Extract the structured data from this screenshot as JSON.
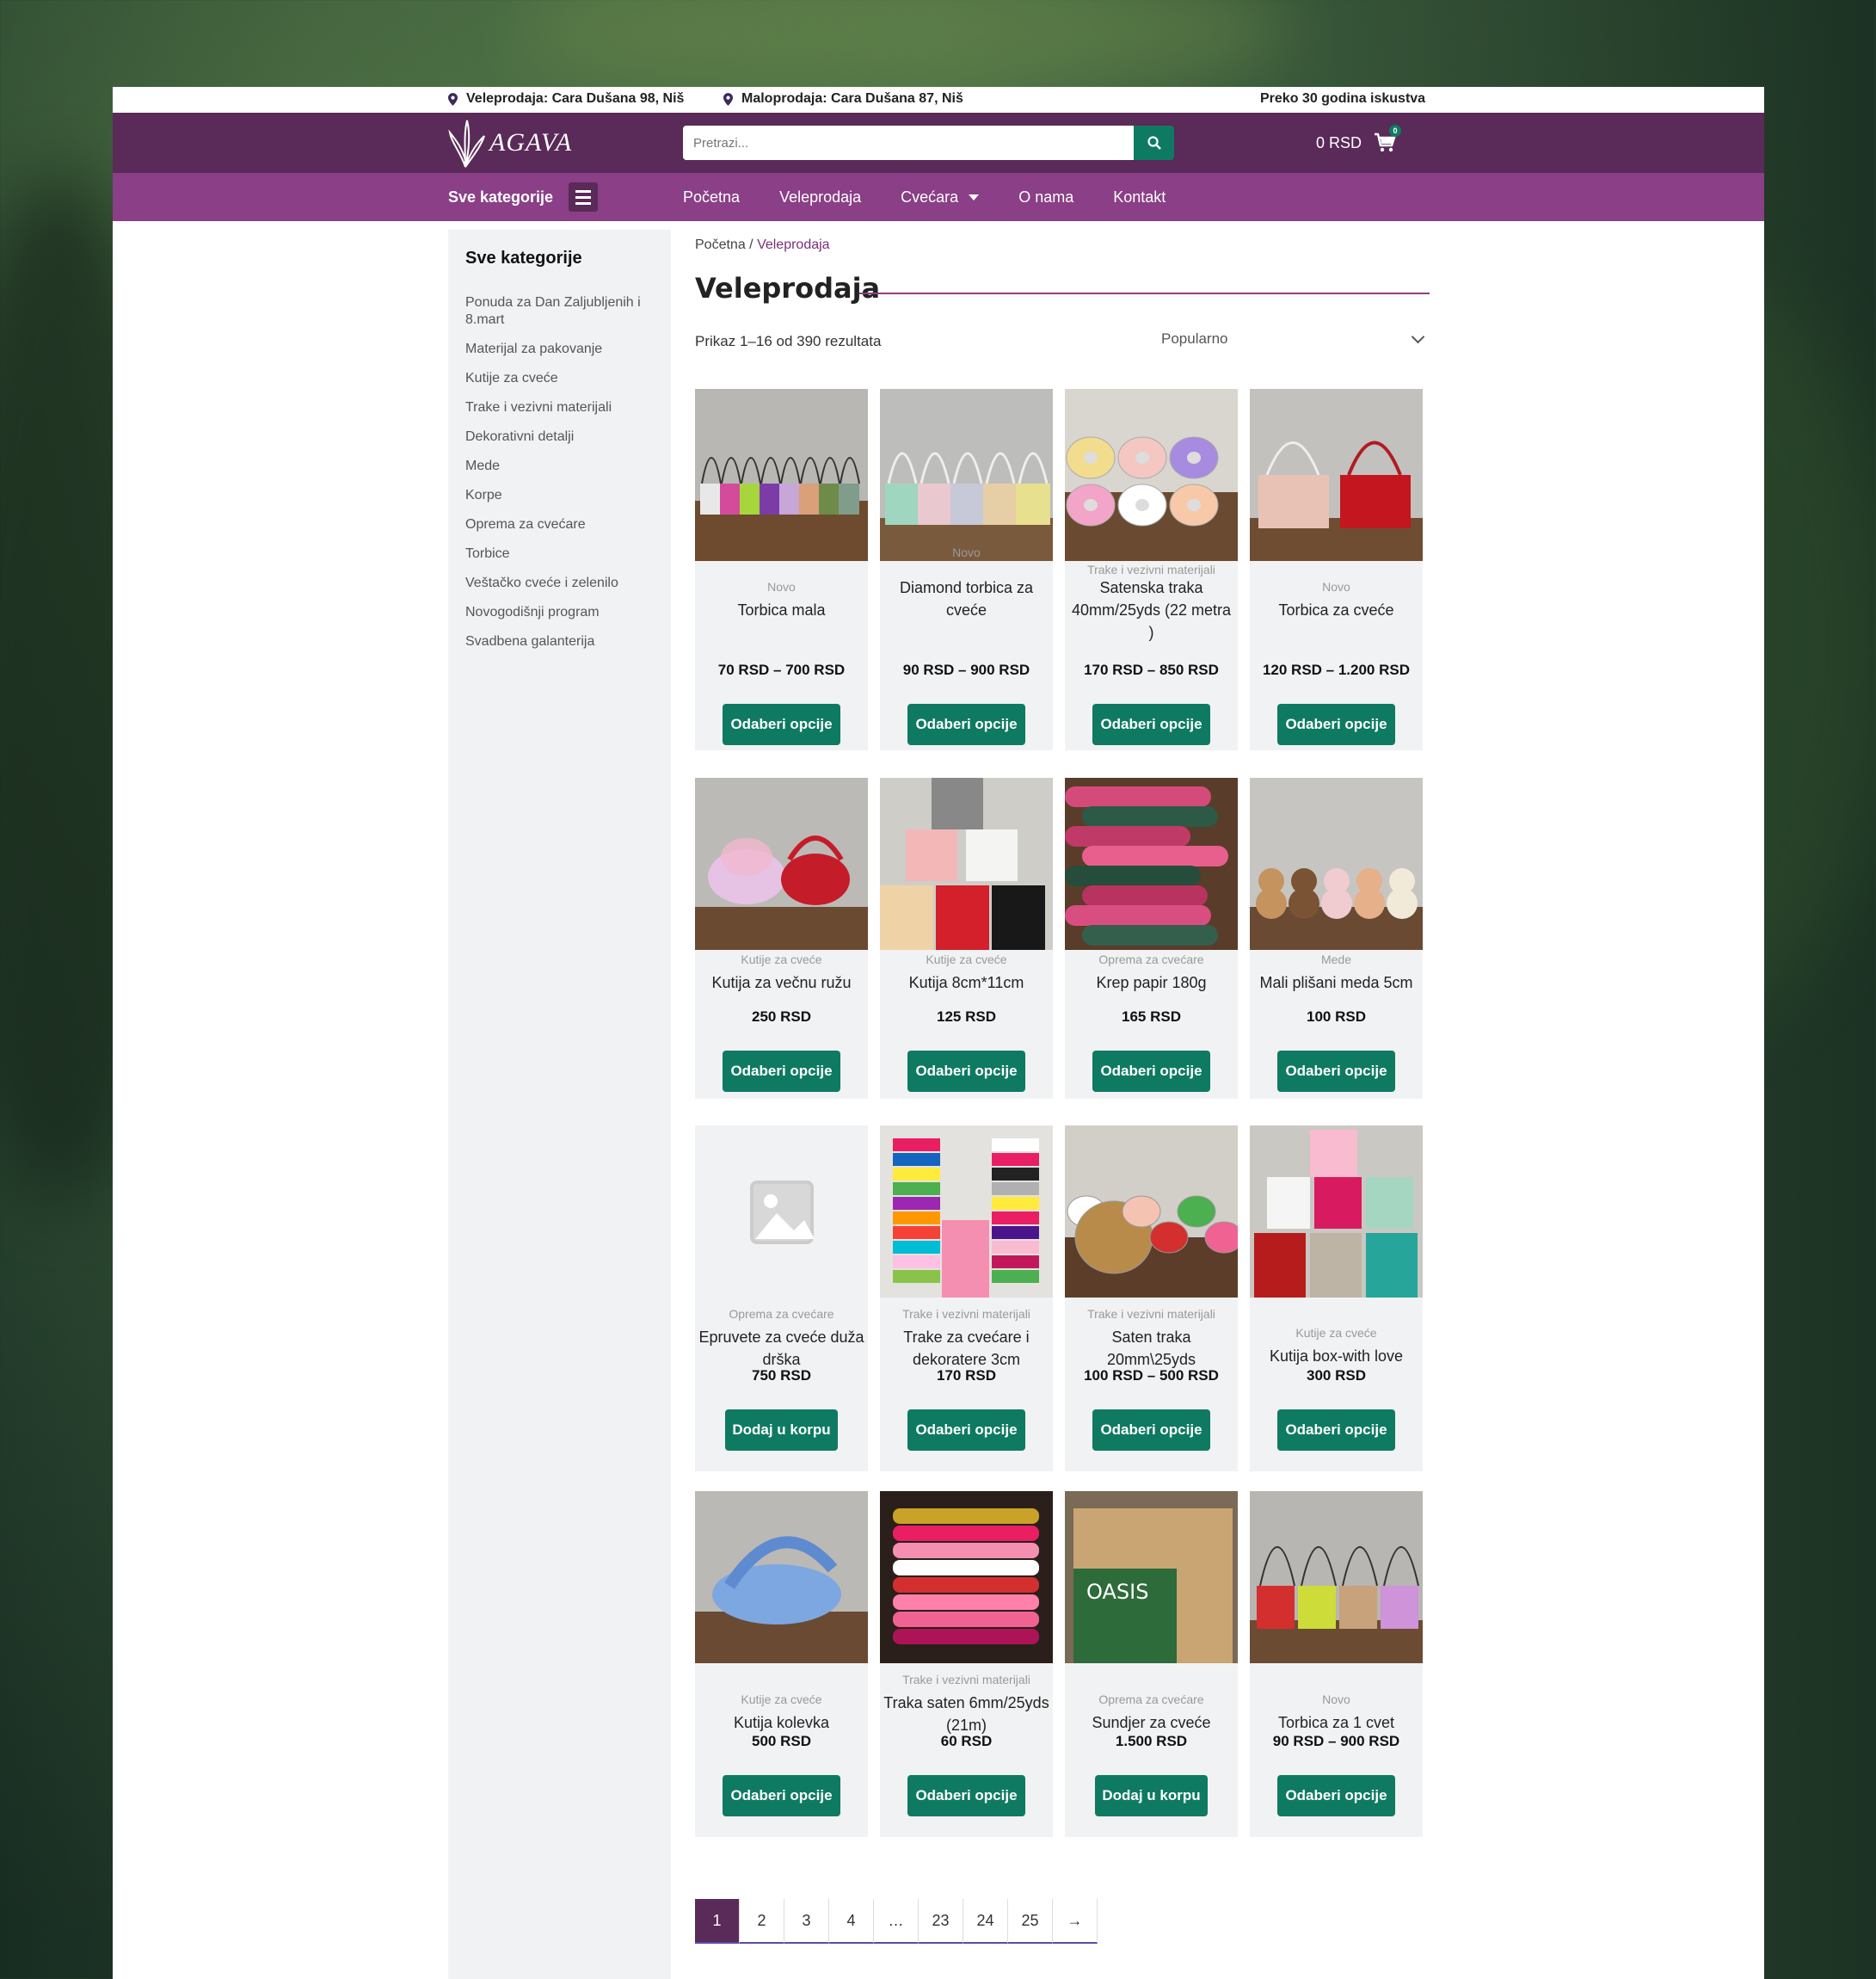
{
  "topbar": {
    "wholesale": "Veleprodaja: Cara Dušana 98, Niš",
    "retail": "Maloprodaja: Cara Dušana 87, Niš",
    "experience": "Preko 30 godina iskustva"
  },
  "header": {
    "logo_text": "AGAVA",
    "search_placeholder": "Pretrazi...",
    "cart_total": "0 RSD",
    "cart_count": "0"
  },
  "nav": {
    "all_categories": "Sve kategorije",
    "items": [
      "Početna",
      "Veleprodaja",
      "Cvećara",
      "O nama",
      "Kontakt"
    ]
  },
  "sidebar": {
    "title": "Sve kategorije",
    "items": [
      "Ponuda za Dan Zaljubljenih i 8.mart",
      "Materijal za pakovanje",
      "Kutije za cveće",
      "Trake i vezivni materijali",
      "Dekorativni detalji",
      "Mede",
      "Korpe",
      "Oprema za cvećare",
      "Torbice",
      "Veštačko cveće i zelenilo",
      "Novogodišnji program",
      "Svadbena galanterija"
    ]
  },
  "breadcrumb": {
    "home": "Početna",
    "sep": " / ",
    "current": "Veleprodaja"
  },
  "page_title": "Veleprodaja",
  "result_count": "Prikaz 1–16 od 390 rezultata",
  "sort": {
    "selected": "Popularno"
  },
  "products": [
    {
      "category": "Novo",
      "name": "Torbica mala",
      "price": "70 RSD – 700 RSD",
      "button": "Odaberi opcije",
      "image": "bags-colorful"
    },
    {
      "category": "Novo",
      "name": "Diamond torbica za cveće",
      "price": "90 RSD – 900 RSD",
      "button": "Odaberi opcije",
      "image": "bags-pastel"
    },
    {
      "category": "Trake i vezivni materijali",
      "name": "Satenska traka 40mm/25yds (22 metra )",
      "price": "170 RSD – 850 RSD",
      "button": "Odaberi opcije",
      "image": "ribbons-wide"
    },
    {
      "category": "Novo",
      "name": "Torbica za cveće",
      "price": "120 RSD – 1.200 RSD",
      "button": "Odaberi opcije",
      "image": "bags-pink-red"
    },
    {
      "category": "Kutije za cveće",
      "name": "Kutija za večnu ružu",
      "price": "250 RSD",
      "button": "Odaberi opcije",
      "image": "rose-box"
    },
    {
      "category": "Kutije za cveće",
      "name": "Kutija 8cm*11cm",
      "price": "125 RSD",
      "button": "Odaberi opcije",
      "image": "box-stack"
    },
    {
      "category": "Oprema za cvećare",
      "name": "Krep papir 180g",
      "price": "165 RSD",
      "button": "Odaberi opcije",
      "image": "crepe-paper"
    },
    {
      "category": "Mede",
      "name": "Mali plišani meda 5cm",
      "price": "100 RSD",
      "button": "Odaberi opcije",
      "image": "teddy-bears"
    },
    {
      "category": "Oprema za cvećare",
      "name": "Epruvete za cveće duža drška",
      "price": "750 RSD",
      "button": "Dodaj u korpu",
      "image": "placeholder"
    },
    {
      "category": "Trake i vezivni materijali",
      "name": "Trake za cvećare i dekoratere 3cm",
      "price": "170 RSD",
      "button": "Odaberi opcije",
      "image": "ribbon-towers"
    },
    {
      "category": "Trake i vezivni materijali",
      "name": "Saten traka 20mm\\25yds",
      "price": "100 RSD – 500 RSD",
      "button": "Odaberi opcije",
      "image": "satin-rolls"
    },
    {
      "category": "Kutije za cveće",
      "name": "Kutija box-with love",
      "price": "300 RSD",
      "button": "Odaberi opcije",
      "image": "hat-boxes"
    },
    {
      "category": "Kutije za cveće",
      "name": "Kutija kolevka",
      "price": "500 RSD",
      "button": "Odaberi opcije",
      "image": "cradle-box"
    },
    {
      "category": "Trake i vezivni materijali",
      "name": "Traka saten 6mm/25yds (21m)",
      "price": "60 RSD",
      "button": "Odaberi opcije",
      "image": "thin-ribbons"
    },
    {
      "category": "Oprema za cvećare",
      "name": "Sundjer za cveće",
      "price": "1.500 RSD",
      "button": "Dodaj u korpu",
      "image": "oasis-box"
    },
    {
      "category": "Novo",
      "name": "Torbica za 1 cvet",
      "price": "90 RSD – 900 RSD",
      "button": "Odaberi opcije",
      "image": "single-bags"
    }
  ],
  "pagination": [
    "1",
    "2",
    "3",
    "4",
    "…",
    "23",
    "24",
    "25",
    "→"
  ],
  "colors": {
    "header": "#5a2a58",
    "nav": "#8a3f86",
    "button": "#0f7a62"
  }
}
